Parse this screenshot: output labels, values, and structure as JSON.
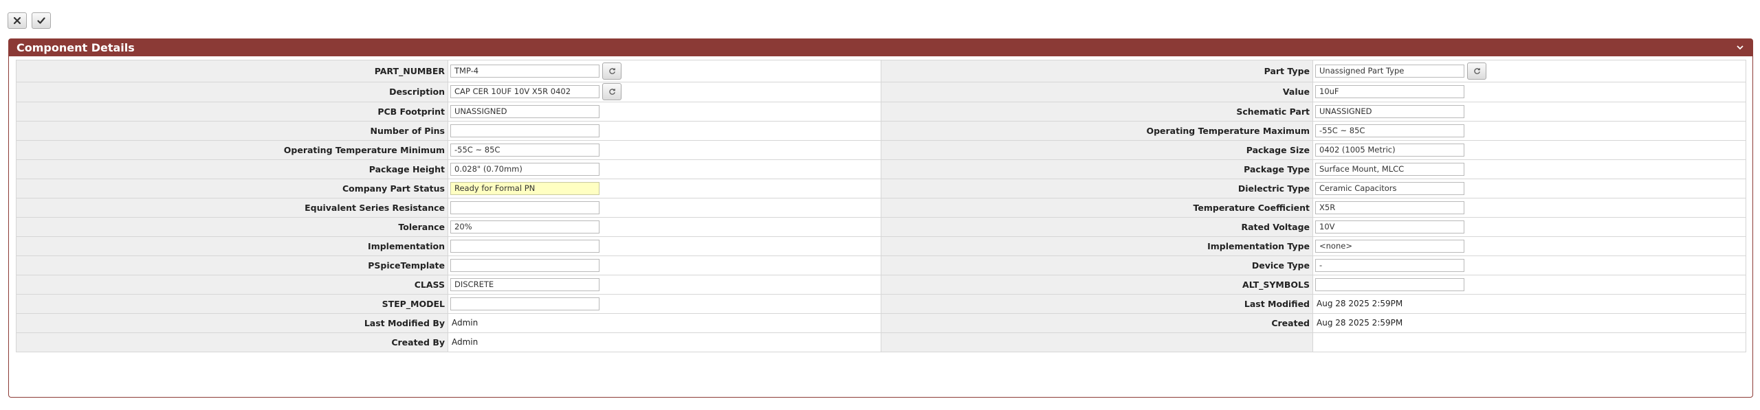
{
  "toolbar": {
    "cancel_icon": "close-icon",
    "confirm_icon": "check-icon"
  },
  "panel": {
    "title": "Component Details",
    "collapse_icon": "chevron-down-icon"
  },
  "rows": [
    {
      "left": {
        "label": "PART_NUMBER",
        "value": "TMP-4"
      },
      "right": {
        "label": "Part Type",
        "value": "Unassigned Part Type"
      }
    },
    {
      "left": {
        "label": "Description",
        "value": "CAP CER 10UF 10V X5R 0402"
      },
      "right": {
        "label": "Value",
        "value": "10uF"
      }
    },
    {
      "left": {
        "label": "PCB Footprint",
        "value": "UNASSIGNED"
      },
      "right": {
        "label": "Schematic Part",
        "value": "UNASSIGNED"
      }
    },
    {
      "left": {
        "label": "Number of Pins",
        "value": ""
      },
      "right": {
        "label": "Operating Temperature Maximum",
        "value": "-55C ~ 85C"
      }
    },
    {
      "left": {
        "label": "Operating Temperature Minimum",
        "value": "-55C ~ 85C"
      },
      "right": {
        "label": "Package Size",
        "value": "0402 (1005 Metric)"
      }
    },
    {
      "left": {
        "label": "Package Height",
        "value": "0.028\" (0.70mm)"
      },
      "right": {
        "label": "Package Type",
        "value": "Surface Mount, MLCC"
      }
    },
    {
      "left": {
        "label": "Company Part Status",
        "value": "Ready for Formal PN"
      },
      "right": {
        "label": "Dielectric Type",
        "value": "Ceramic Capacitors"
      }
    },
    {
      "left": {
        "label": "Equivalent Series Resistance",
        "value": ""
      },
      "right": {
        "label": "Temperature Coefficient",
        "value": "X5R"
      }
    },
    {
      "left": {
        "label": "Tolerance",
        "value": "20%"
      },
      "right": {
        "label": "Rated Voltage",
        "value": "10V"
      }
    },
    {
      "left": {
        "label": "Implementation",
        "value": ""
      },
      "right": {
        "label": "Implementation Type",
        "value": "<none>"
      }
    },
    {
      "left": {
        "label": "PSpiceTemplate",
        "value": ""
      },
      "right": {
        "label": "Device Type",
        "value": "-"
      }
    },
    {
      "left": {
        "label": "CLASS",
        "value": "DISCRETE"
      },
      "right": {
        "label": "ALT_SYMBOLS",
        "value": ""
      }
    },
    {
      "left": {
        "label": "STEP_MODEL",
        "value": ""
      },
      "right": {
        "label": "Last Modified",
        "value": "Aug 28 2025 2:59PM"
      }
    },
    {
      "left": {
        "label": "Last Modified By",
        "value": "Admin"
      },
      "right": {
        "label": "Created",
        "value": "Aug 28 2025 2:59PM"
      }
    },
    {
      "left": {
        "label": "Created By",
        "value": "Admin"
      },
      "right": {
        "label": "",
        "value": ""
      }
    }
  ],
  "colors": {
    "header_bg": "#8b3a36",
    "label_bg": "#efefef",
    "highlight_field": "#ffffc2"
  }
}
